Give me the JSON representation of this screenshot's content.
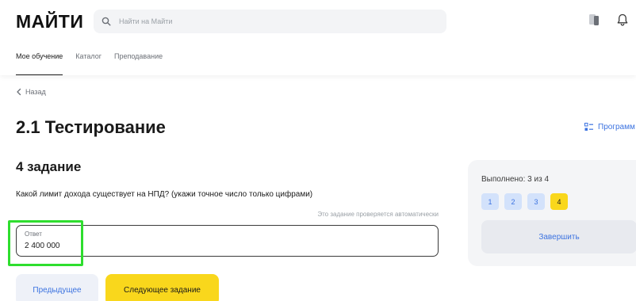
{
  "header": {
    "logo": "МАЙТИ",
    "search_placeholder": "Найти на Майти",
    "nav": [
      {
        "label": "Мое обучение",
        "active": true
      },
      {
        "label": "Каталог",
        "active": false
      },
      {
        "label": "Преподавание",
        "active": false
      }
    ]
  },
  "back_label": "Назад",
  "page_title": "2.1 Тестирование",
  "program_link": "Программ",
  "task": {
    "title": "4 задание",
    "question": "Какой лимит дохода существует на НПД? (укажи точное число только цифрами)",
    "auto_note": "Это задание проверяется автоматически",
    "answer_label": "Ответ",
    "answer_value": "2 400 000"
  },
  "buttons": {
    "prev": "Предыдущее",
    "next": "Следующее задание"
  },
  "progress": {
    "done_text": "Выполнено: 3 из 4",
    "completed": 3,
    "total": 4,
    "tasks": [
      "1",
      "2",
      "3",
      "4"
    ],
    "finish": "Завершить"
  },
  "colors": {
    "accent_blue": "#3c73e0",
    "accent_yellow": "#f9d71c",
    "highlight_green": "#2ede2e"
  }
}
